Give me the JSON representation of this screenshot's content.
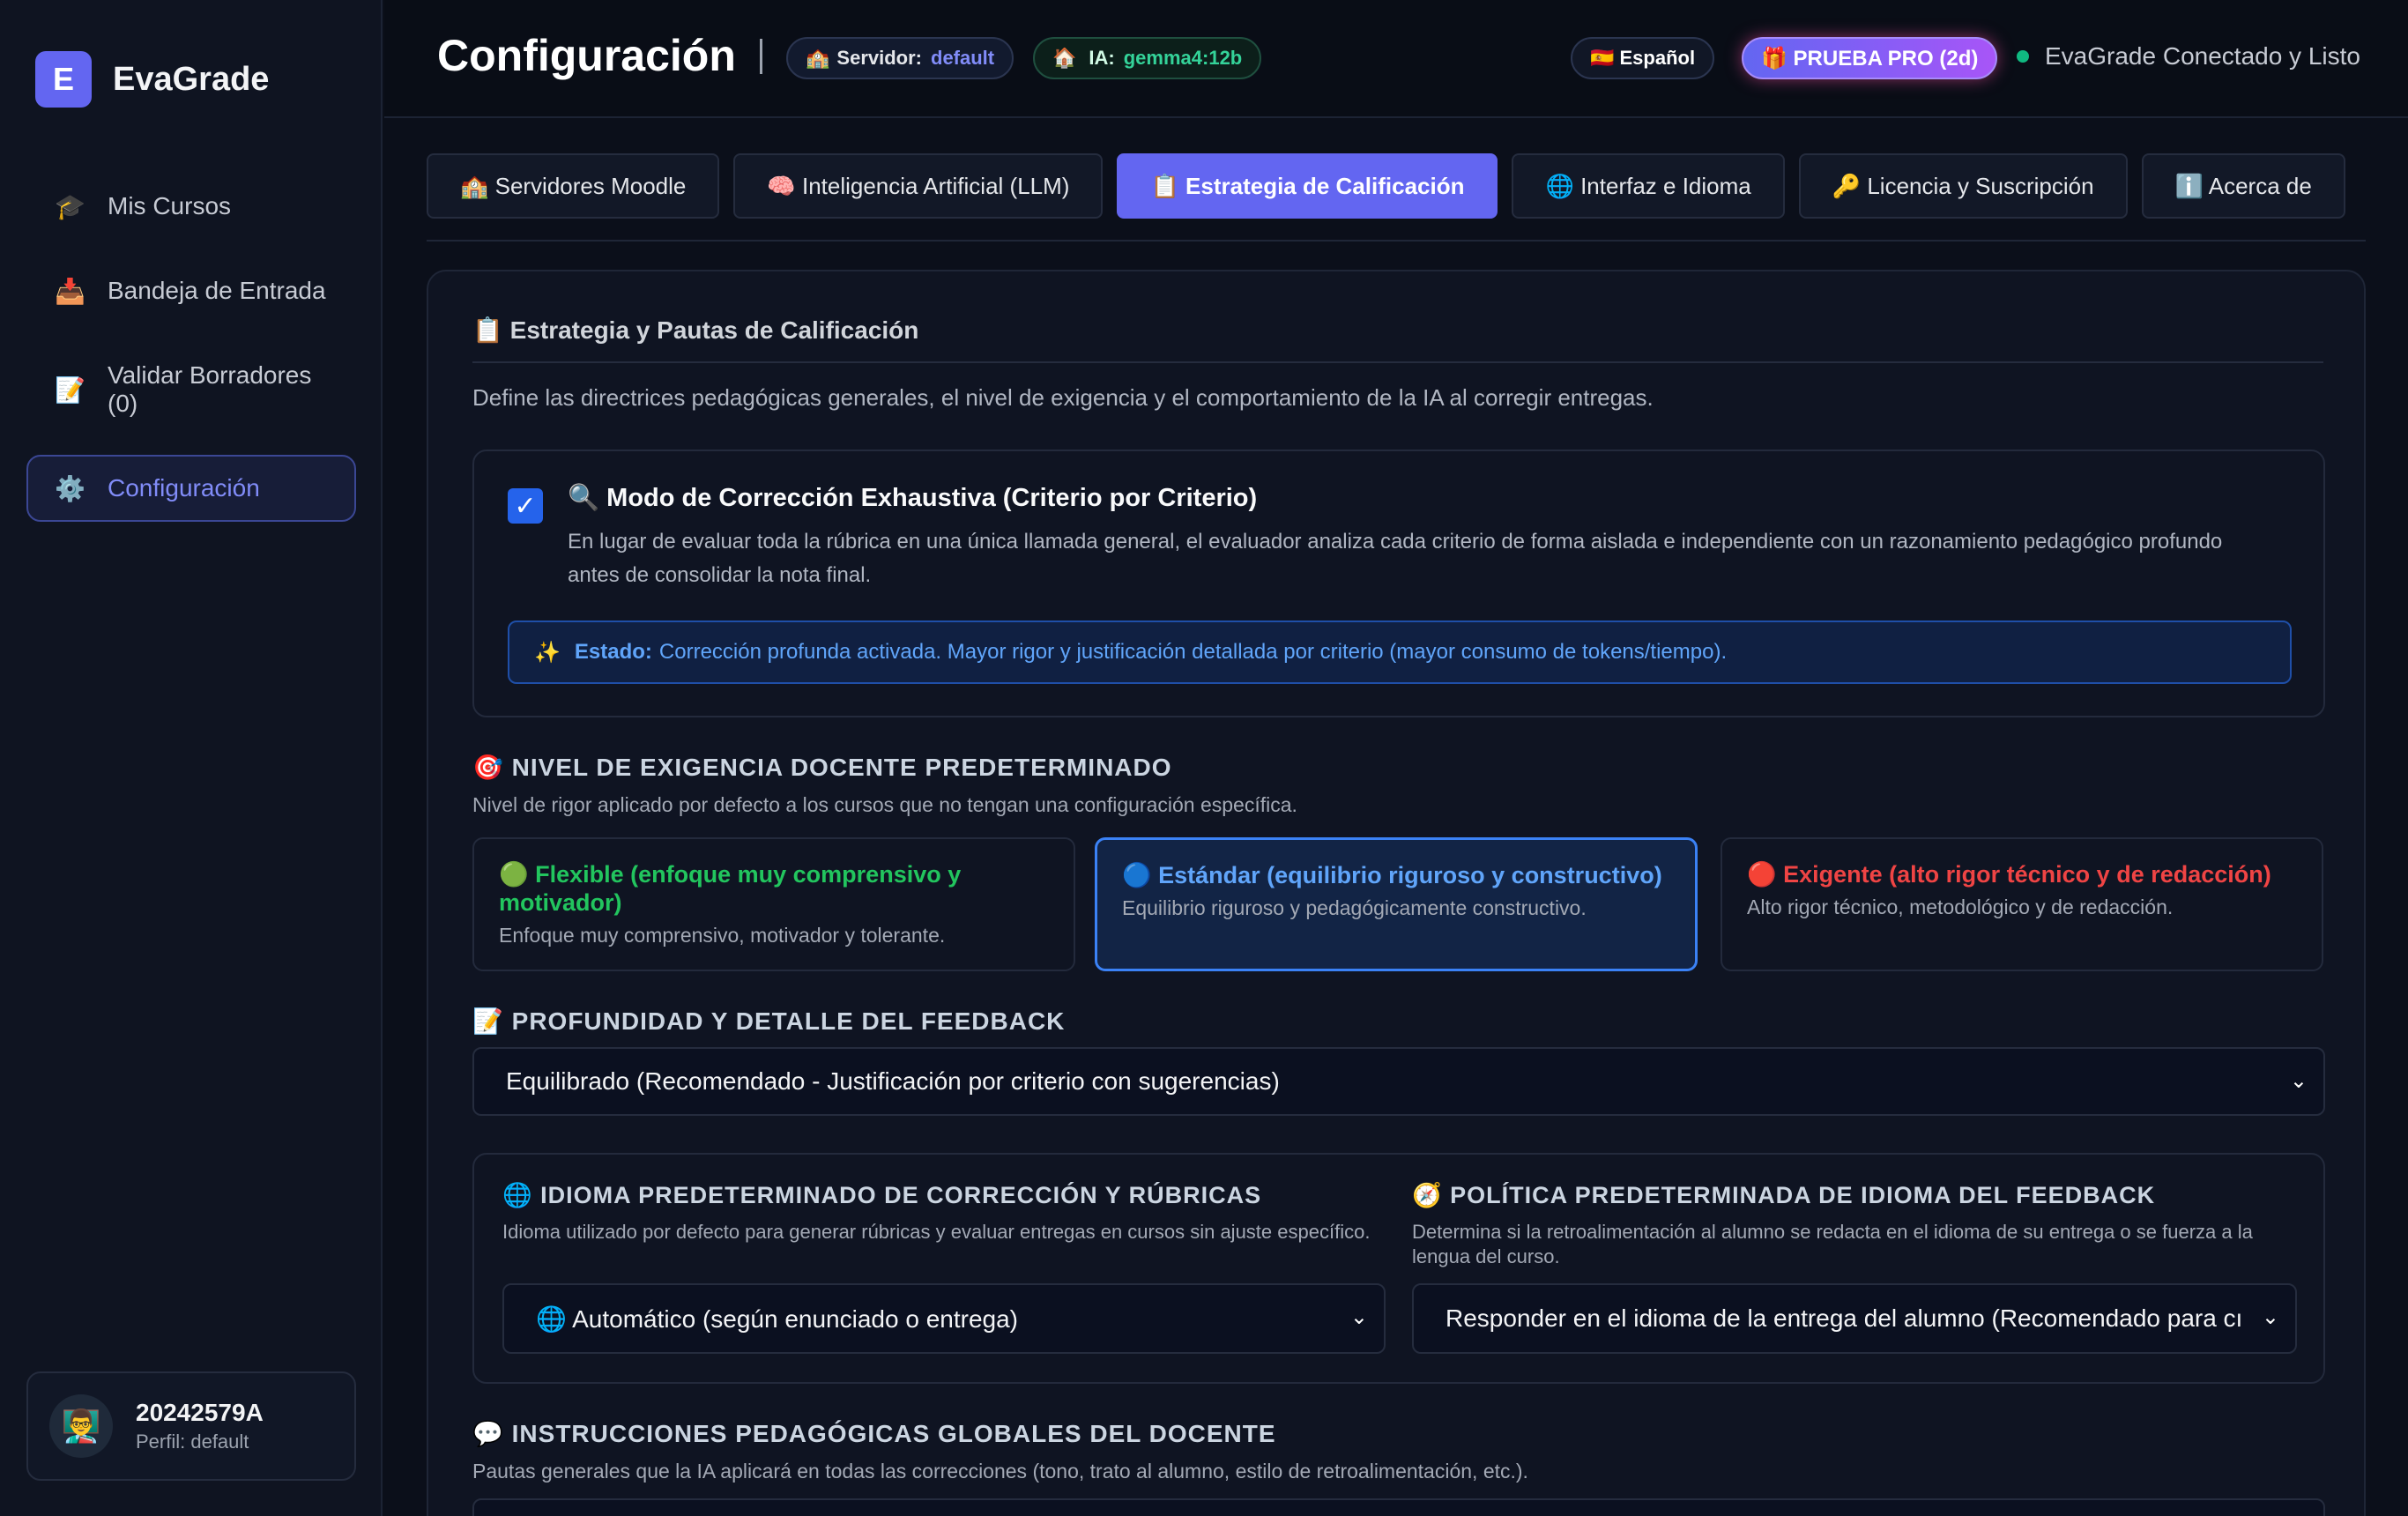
{
  "sidebar": {
    "brand_initial": "E",
    "brand_name": "EvaGrade",
    "items": [
      {
        "icon": "🎓",
        "label": "Mis Cursos"
      },
      {
        "icon": "📥",
        "label": "Bandeja de Entrada"
      },
      {
        "icon": "📝",
        "label": "Validar Borradores (0)"
      },
      {
        "icon": "⚙️",
        "label": "Configuración"
      }
    ],
    "user": {
      "avatar": "👨‍🏫",
      "id": "20242579A",
      "profile": "Perfil: default"
    }
  },
  "header": {
    "title": "Configuración",
    "server": {
      "icon": "🏫",
      "label": "Servidor:",
      "value": "default"
    },
    "ai": {
      "icon": "🏠",
      "label": "IA:",
      "value": "gemma4:12b"
    },
    "language": "🇪🇸 Español",
    "pro": "🎁 PRUEBA PRO (2d)",
    "status": "EvaGrade Conectado y Listo"
  },
  "tabs": [
    {
      "label": "🏫 Servidores Moodle"
    },
    {
      "label": "🧠 Inteligencia Artificial (LLM)"
    },
    {
      "label": "📋 Estrategia de Calificación"
    },
    {
      "label": "🌐 Interfaz e Idioma"
    },
    {
      "label": "🔑 Licencia y Suscripción"
    },
    {
      "label": "ℹ️ Acerca de"
    }
  ],
  "panel": {
    "title": "📋 Estrategia y Pautas de Calificación",
    "description": "Define las directrices pedagógicas generales, el nivel de exigencia y el comportamiento de la IA al corregir entregas.",
    "exhaustive": {
      "checked": true,
      "check_glyph": "✓",
      "title": "🔍 Modo de Corrección Exhaustiva (Criterio por Criterio)",
      "description": "En lugar de evaluar toda la rúbrica en una única llamada general, el evaluador analiza cada criterio de forma aislada e independiente con un razonamiento pedagógico profundo antes de consolidar la nota final.",
      "state_icon": "✨",
      "state_label": "Estado:",
      "state_text": "Corrección profunda activada. Mayor rigor y justificación detallada por criterio (mayor consumo de tokens/tiempo)."
    },
    "level": {
      "title": "🎯 NIVEL DE EXIGENCIA DOCENTE PREDETERMINADO",
      "subtitle": "Nivel de rigor aplicado por defecto a los cursos que no tengan una configuración específica.",
      "options": [
        {
          "title": "🟢 Flexible (enfoque muy comprensivo y motivador)",
          "description": "Enfoque muy comprensivo, motivador y tolerante."
        },
        {
          "title": "🔵 Estándar (equilibrio riguroso y constructivo)",
          "description": "Equilibrio riguroso y pedagógicamente constructivo."
        },
        {
          "title": "🔴 Exigente (alto rigor técnico y de redacción)",
          "description": "Alto rigor técnico, metodológico y de redacción."
        }
      ]
    },
    "feedback": {
      "title": "📝 PROFUNDIDAD Y DETALLE DEL FEEDBACK",
      "selected": "Equilibrado (Recomendado - Justificación por criterio con sugerencias)"
    },
    "language_default": {
      "title": "🌐 IDIOMA PREDETERMINADO DE CORRECCIÓN Y RÚBRICAS",
      "subtitle": "Idioma utilizado por defecto para generar rúbricas y evaluar entregas en cursos sin ajuste específico.",
      "selected": "🌐 Automático (según enunciado o entrega)"
    },
    "language_policy": {
      "title": "🧭 POLÍTICA PREDETERMINADA DE IDIOMA DEL FEEDBACK",
      "subtitle": "Determina si la retroalimentación al alumno se redacta en el idioma de su entrega o se fuerza a la lengua del curso.",
      "selected": "Responder en el idioma de la entrega del alumno (Recomendado para cı"
    },
    "instructions": {
      "title": "💬 INSTRUCCIONES PEDAGÓGICAS GLOBALES DEL DOCENTE",
      "subtitle": "Pautas generales que la IA aplicará en todas las correcciones (tono, trato al alumno, estilo de retroalimentación, etc.)."
    }
  },
  "chevron": "⌄"
}
